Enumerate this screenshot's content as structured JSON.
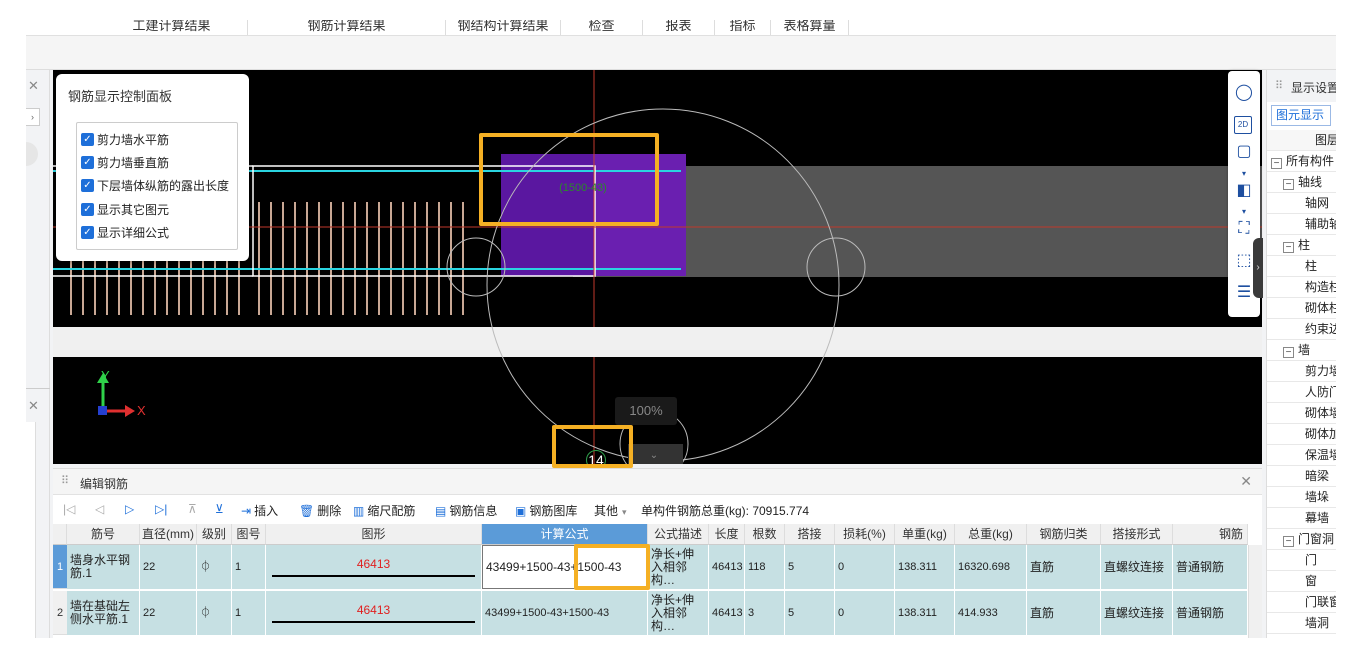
{
  "menubar": {
    "items": [
      "工建计算结果",
      "钢筋计算结果",
      "钢结构计算结果",
      "检查",
      "报表",
      "指标",
      "表格算量"
    ]
  },
  "control_panel": {
    "title": "钢筋显示控制面板",
    "options": [
      {
        "label": "剪力墙水平筋",
        "checked": true
      },
      {
        "label": "剪力墙垂直筋",
        "checked": true
      },
      {
        "label": "下层墙体纵筋的露出长度",
        "checked": true
      },
      {
        "label": "显示其它图元",
        "checked": true
      },
      {
        "label": "显示详细公式",
        "checked": true
      }
    ]
  },
  "canvas": {
    "dimension_label": "(1500-43)",
    "zoom": "100%",
    "page_number": "14",
    "axis_x": "X",
    "axis_y": "Y"
  },
  "right_panel": {
    "title": "显示设置",
    "tab": "图元显示",
    "column_header": "图层",
    "tree": [
      {
        "label": "所有构件",
        "level": 0,
        "toggle": "−"
      },
      {
        "label": "轴线",
        "level": 1,
        "toggle": "−"
      },
      {
        "label": "轴网",
        "level": 2
      },
      {
        "label": "辅助轴线",
        "level": 2
      },
      {
        "label": "柱",
        "level": 1,
        "toggle": "−"
      },
      {
        "label": "柱",
        "level": 2
      },
      {
        "label": "构造柱",
        "level": 2
      },
      {
        "label": "砌体柱",
        "level": 2
      },
      {
        "label": "约束边缘",
        "level": 2
      },
      {
        "label": "墙",
        "level": 1,
        "toggle": "−"
      },
      {
        "label": "剪力墙",
        "level": 2
      },
      {
        "label": "人防门框墙",
        "level": 2
      },
      {
        "label": "砌体墙",
        "level": 2
      },
      {
        "label": "砌体加筋",
        "level": 2
      },
      {
        "label": "保温墙",
        "level": 2
      },
      {
        "label": "暗梁",
        "level": 2
      },
      {
        "label": "墙垛",
        "level": 2
      },
      {
        "label": "幕墙",
        "level": 2
      },
      {
        "label": "门窗洞",
        "level": 1,
        "toggle": "−"
      },
      {
        "label": "门",
        "level": 2
      },
      {
        "label": "窗",
        "level": 2
      },
      {
        "label": "门联窗",
        "level": 2
      },
      {
        "label": "墙洞",
        "level": 2
      }
    ]
  },
  "edit_panel": {
    "title": "编辑钢筋",
    "toolbar": {
      "insert": "插入",
      "delete": "删除",
      "scale_rebar": "缩尺配筋",
      "rebar_info": "钢筋信息",
      "rebar_library": "钢筋图库",
      "other": "其他",
      "total_weight": "单构件钢筋总重(kg): 70915.774"
    },
    "columns": [
      "筋号",
      "直径(mm)",
      "级别",
      "图号",
      "图形",
      "计算公式",
      "公式描述",
      "长度",
      "根数",
      "搭接",
      "损耗(%)",
      "单重(kg)",
      "总重(kg)",
      "钢筋归类",
      "搭接形式",
      "钢筋"
    ],
    "rows": [
      {
        "num": "1",
        "name": "墙身水平钢筋.1",
        "diameter": "22",
        "grade": "⏀",
        "fig": "1",
        "shape_value": "46413",
        "formula": "43499+1500-43+1500-43",
        "formula_desc": "净长+伸入相邻构…",
        "length": "46413",
        "count": "118",
        "lap": "5",
        "loss": "0",
        "unit_weight": "138.311",
        "total_weight": "16320.698",
        "category": "直筋",
        "lap_type": "直螺纹连接",
        "rebar_type": "普通钢筋"
      },
      {
        "num": "2",
        "name": "墙在基础左侧水平筋.1",
        "diameter": "22",
        "grade": "⏀",
        "fig": "1",
        "shape_value": "46413",
        "formula": "43499+1500-43+1500-43",
        "formula_desc": "净长+伸入相邻构…",
        "length": "46413",
        "count": "3",
        "lap": "5",
        "loss": "0",
        "unit_weight": "138.311",
        "total_weight": "414.933",
        "category": "直筋",
        "lap_type": "直螺纹连接",
        "rebar_type": "普通钢筋"
      }
    ]
  }
}
